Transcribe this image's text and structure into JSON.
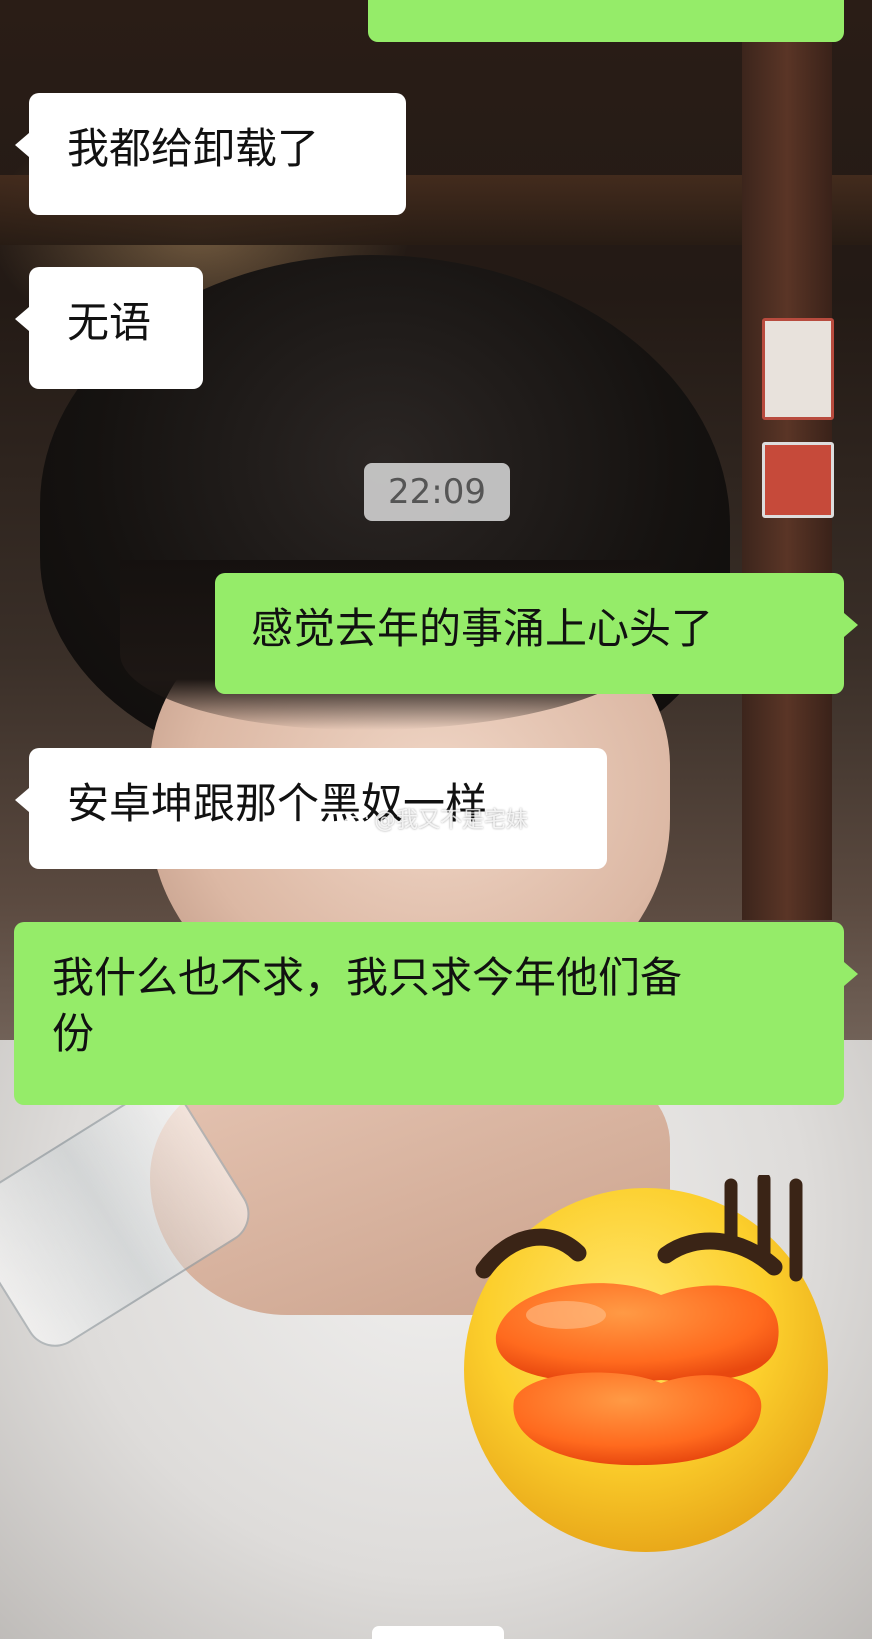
{
  "conversation": {
    "messages": [
      {
        "side": "outgoing",
        "lines": [
          ""
        ]
      },
      {
        "side": "incoming",
        "lines": [
          "我都给卸载了"
        ]
      },
      {
        "side": "incoming",
        "lines": [
          "无语"
        ]
      },
      {
        "side": "outgoing",
        "lines": [
          "感觉去年的事涌上心头了"
        ]
      },
      {
        "side": "incoming",
        "lines": [
          "安卓坤跟那个黑奴一样"
        ]
      },
      {
        "side": "outgoing",
        "lines": [
          "我什么也不求，我只求今年他们备",
          "份"
        ]
      }
    ],
    "timestamp": "22:09"
  },
  "sticker": {
    "icon": "yellow-duck-face-sweat-emoji"
  },
  "watermark": {
    "text": "@我又不是宅妹",
    "icon": "weibo-logo-icon"
  },
  "colors": {
    "incoming_bubble": "#ffffff",
    "outgoing_bubble": "#95ec69",
    "timestamp_bg": "#cdcdcd"
  }
}
